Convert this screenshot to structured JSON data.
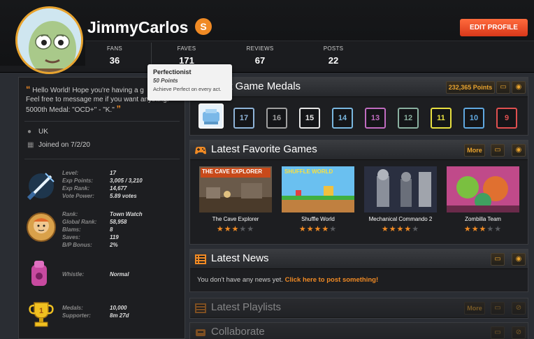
{
  "profile": {
    "username": "JimmyCarlos",
    "supporter_badge": "S",
    "edit_label": "EDIT PROFILE"
  },
  "stats": [
    {
      "label": "FANS",
      "value": "36"
    },
    {
      "label": "FAVES",
      "value": "171"
    },
    {
      "label": "REVIEWS",
      "value": "67"
    },
    {
      "label": "POSTS",
      "value": "22"
    }
  ],
  "about": {
    "blurb": "Hello World! Hope you're having a g... Feel free to message me if you want anything. 5000th Medal: \"OCD+\" - \"K.\"",
    "blurb_l1": "Hello World! Hope you're having a g",
    "blurb_l2": "Feel free to message me if you want anything.",
    "blurb_l3": "5000th Medal: \"OCD+\" - \"K.\"",
    "location": "UK",
    "joined": "Joined on 7/2/20"
  },
  "level_stats": {
    "labels": [
      "Level:",
      "Exp Points:",
      "Exp Rank:",
      "Vote Power:"
    ],
    "values": [
      "17",
      "3,005 / 3,210",
      "14,677",
      "5.89 votes"
    ]
  },
  "rank_stats": {
    "labels": [
      "Rank:",
      "Global Rank:",
      "Blams:",
      "Saves:",
      "B/P Bonus:"
    ],
    "values": [
      "Town Watch",
      "58,958",
      "8",
      "119",
      "2%"
    ]
  },
  "whistle": {
    "label": "Whistle:",
    "value": "Normal"
  },
  "medal_stats": {
    "labels": [
      "Medals:",
      "Supporter:"
    ],
    "values": [
      "10,000",
      "8m 27d"
    ]
  },
  "medals_panel": {
    "title": "Recent Game Medals",
    "title_visible": "nt Game Medals",
    "points": "232,365 Points",
    "medals": [
      {
        "text": "17",
        "color": "#8fb4d8"
      },
      {
        "text": "16",
        "color": "#a0a0a0"
      },
      {
        "text": "15",
        "color": "#e6e6e6"
      },
      {
        "text": "14",
        "color": "#7ab8e0"
      },
      {
        "text": "13",
        "color": "#c06cc0"
      },
      {
        "text": "12",
        "color": "#8ab0a0"
      },
      {
        "text": "11",
        "color": "#e8e040"
      },
      {
        "text": "10",
        "color": "#60a8e0"
      },
      {
        "text": "9",
        "color": "#e05050"
      }
    ]
  },
  "tooltip": {
    "title": "Perfectionist",
    "points": "50 Points",
    "desc": "Achieve Perfect on every act."
  },
  "games_panel": {
    "title": "Latest Favorite Games",
    "more": "More",
    "games": [
      {
        "title": "The Cave Explorer",
        "stars": 3
      },
      {
        "title": "Shuffle World",
        "stars": 4
      },
      {
        "title": "Mechanical Commando 2",
        "stars": 4
      },
      {
        "title": "Zombilla Team",
        "stars": 3
      }
    ],
    "thumb_labels": [
      "THE CAVE EXPLORER",
      "SHUFFLE WORLD"
    ]
  },
  "news_panel": {
    "title": "Latest News",
    "empty_text": "You don't have any news yet.",
    "link": "Click here to post something!"
  },
  "playlists_panel": {
    "title": "Latest Playlists",
    "more": "More"
  },
  "collab_panel": {
    "title": "Collaborate"
  }
}
